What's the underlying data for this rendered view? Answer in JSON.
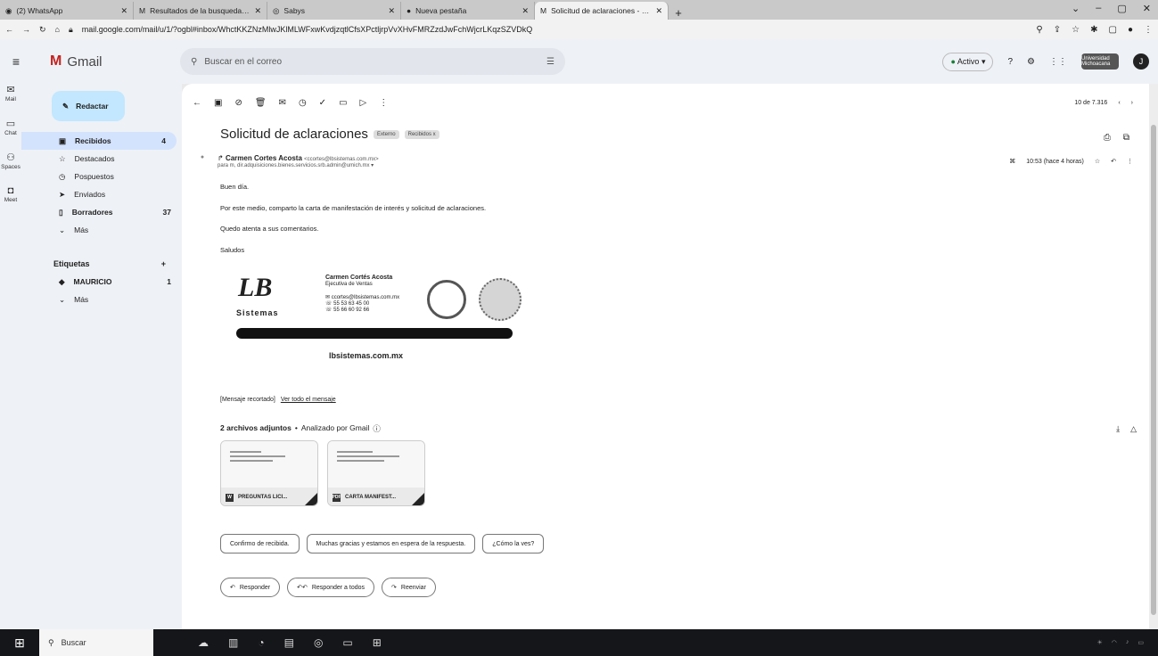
{
  "browser": {
    "tabs": [
      {
        "title": "(2) WhatsApp",
        "icon": "whatsapp-icon"
      },
      {
        "title": "Resultados de la busqueda - jair",
        "icon": "gmail-icon"
      },
      {
        "title": "Sabys",
        "icon": "sabys-icon"
      },
      {
        "title": "Nueva pestaña",
        "icon": "chrome-icon"
      },
      {
        "title": "Solicitud de aclaraciones - dicai",
        "icon": "gmail-icon",
        "active": true
      }
    ],
    "url": "mail.google.com/mail/u/1/?ogbl#inbox/WhctKKZNzMlwJKlMLWFxwKvdjzqtlCfsXPctljrpVvXHvFMRZzdJwFchWjcrLKqzSZVDkQ"
  },
  "gmail": {
    "app_name": "Gmail",
    "search_placeholder": "Buscar en el correo",
    "status": "Activo",
    "org_badge": "Universidad Michoacana",
    "avatar_letter": "J"
  },
  "rail": [
    {
      "label": "Mail",
      "icon": "mail-icon"
    },
    {
      "label": "Chat",
      "icon": "chat-icon"
    },
    {
      "label": "Spaces",
      "icon": "spaces-icon"
    },
    {
      "label": "Meet",
      "icon": "meet-icon"
    }
  ],
  "sidebar": {
    "compose": "Redactar",
    "items": [
      {
        "label": "Recibidos",
        "count": "4",
        "icon": "inbox-icon"
      },
      {
        "label": "Destacados",
        "count": "",
        "icon": "star-icon"
      },
      {
        "label": "Pospuestos",
        "count": "",
        "icon": "clock-icon"
      },
      {
        "label": "Enviados",
        "count": "",
        "icon": "send-icon"
      },
      {
        "label": "Borradores",
        "count": "37",
        "icon": "draft-icon"
      },
      {
        "label": "Más",
        "count": "",
        "icon": "chevron-down-icon"
      }
    ],
    "labels_title": "Etiquetas",
    "labels": [
      {
        "label": "MAURICIO",
        "count": "1"
      },
      {
        "label": "Más",
        "count": ""
      }
    ]
  },
  "email": {
    "pagination": "10 de 7.316",
    "subject": "Solicitud de aclaraciones",
    "chips": [
      "Externo",
      "Recibidos x"
    ],
    "sender_name": "Carmen Cortes Acosta",
    "sender_email": "<ccortes@lbsistemas.com.mx>",
    "to": "para m, dir.adquisiciones.bienes.servicios.srb.admin@umich.mx",
    "time": "10:53 (hace 4 horas)",
    "body": [
      "Buen día.",
      "Por este medio, comparto la carta de manifestación de interés y solicitud de aclaraciones.",
      "Quedo atenta a sus comentarios.",
      "Saludos"
    ],
    "signature": {
      "logo": "LB",
      "brand": "Sistemas",
      "name": "Carmen Cortés Acosta",
      "role": "Ejecutiva de Ventas",
      "email": "ccortes@lbsistemas.com.mx",
      "phone1": "55 53 63 45 00",
      "phone2": "55 66 60 92 66",
      "website": "lbsistemas.com.mx"
    },
    "trimmed": "[Mensaje recortado]",
    "view_all": "Ver todo el mensaje",
    "attachments_title": "2 archivos adjuntos",
    "scanned": "Analizado por Gmail",
    "attachments": [
      {
        "name": "PREGUNTAS LICI...",
        "type": "W"
      },
      {
        "name": "CARTA MANIFEST...",
        "type": "PDF"
      }
    ],
    "smart_replies": [
      "Confirmo de recibida.",
      "Muchas gracias y estamos en espera de la respuesta.",
      "¿Cómo la ves?"
    ],
    "actions": [
      "Responder",
      "Responder a todos",
      "Reenviar"
    ]
  },
  "taskbar": {
    "search": "Buscar"
  }
}
